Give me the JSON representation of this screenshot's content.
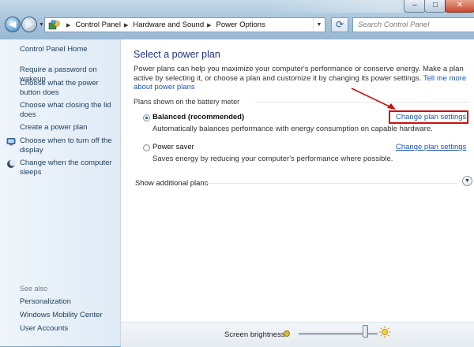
{
  "window": {
    "minimize": "–",
    "maximize": "□",
    "close": "✕"
  },
  "address_bar": {
    "breadcrumbs": [
      "Control Panel",
      "Hardware and Sound",
      "Power Options"
    ],
    "search_placeholder": "Search Control Panel"
  },
  "sidebar": {
    "home": "Control Panel Home",
    "links": [
      {
        "label": "Require a password on wakeup",
        "icon": null
      },
      {
        "label": "Choose what the power button does",
        "icon": null
      },
      {
        "label": "Choose what closing the lid does",
        "icon": null
      },
      {
        "label": "Create a power plan",
        "icon": null
      },
      {
        "label": "Choose when to turn off the display",
        "icon": "monitor-icon"
      },
      {
        "label": "Change when the computer sleeps",
        "icon": "moon-icon"
      }
    ],
    "see_also": {
      "heading": "See also",
      "links": [
        "Personalization",
        "Windows Mobility Center",
        "User Accounts"
      ]
    }
  },
  "main": {
    "title": "Select a power plan",
    "description": "Power plans can help you maximize your computer's performance or conserve energy. Make a plan active by selecting it, or choose a plan and customize it by changing its power settings.",
    "tell_me_more": "Tell me more about power plans",
    "group_label": "Plans shown on the battery meter",
    "plans": [
      {
        "name": "Balanced (recommended)",
        "description": "Automatically balances performance with energy consumption on capable hardware.",
        "link": "Change plan settings",
        "selected": true
      },
      {
        "name": "Power saver",
        "description": "Saves energy by reducing your computer's performance where possible.",
        "link": "Change plan settings",
        "selected": false
      }
    ],
    "show_additional": "Show additional plans"
  },
  "status": {
    "brightness_label": "Screen brightness:",
    "brightness_level_percent": 87
  },
  "annotation_color": "#cc1010",
  "link_color": "#1a55b8",
  "title_color": "#1e3287"
}
